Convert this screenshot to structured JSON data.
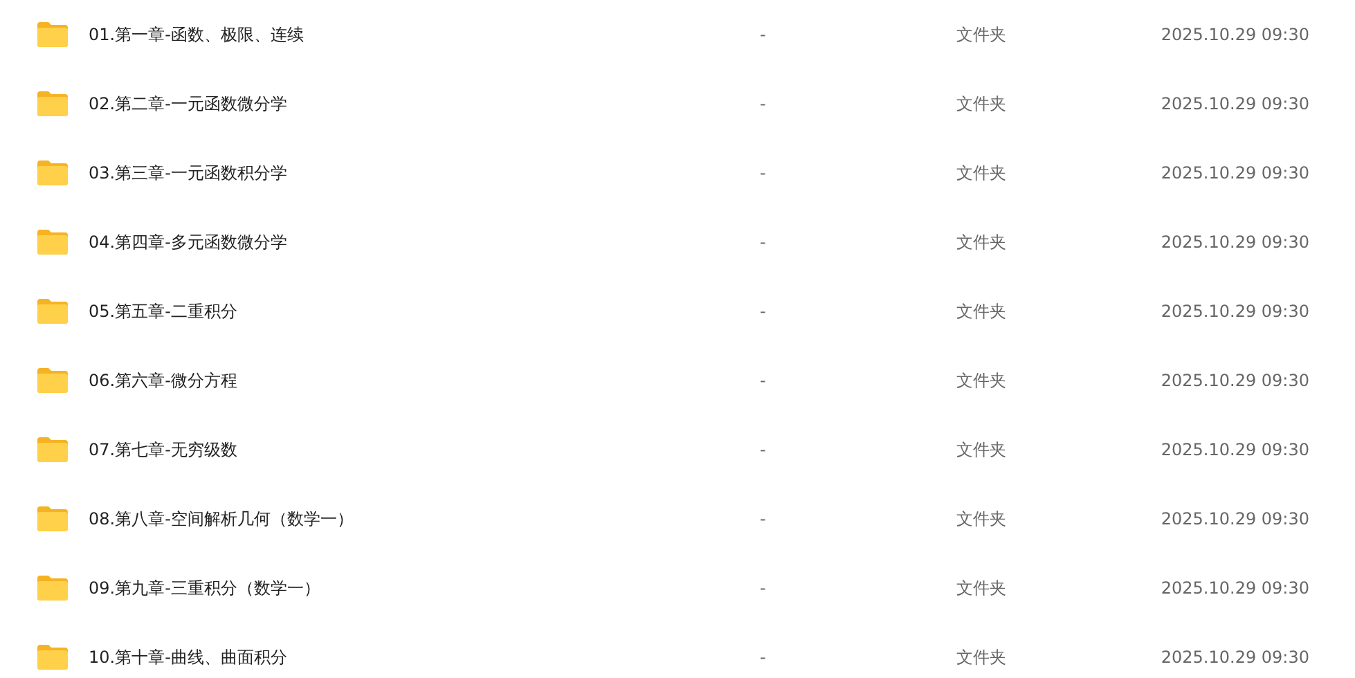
{
  "files": [
    {
      "name": "01.第一章-函数、极限、连续",
      "size": "-",
      "type": "文件夹",
      "modified": "2025.10.29 09:30"
    },
    {
      "name": "02.第二章-一元函数微分学",
      "size": "-",
      "type": "文件夹",
      "modified": "2025.10.29 09:30"
    },
    {
      "name": "03.第三章-一元函数积分学",
      "size": "-",
      "type": "文件夹",
      "modified": "2025.10.29 09:30"
    },
    {
      "name": "04.第四章-多元函数微分学",
      "size": "-",
      "type": "文件夹",
      "modified": "2025.10.29 09:30"
    },
    {
      "name": "05.第五章-二重积分",
      "size": "-",
      "type": "文件夹",
      "modified": "2025.10.29 09:30"
    },
    {
      "name": "06.第六章-微分方程",
      "size": "-",
      "type": "文件夹",
      "modified": "2025.10.29 09:30"
    },
    {
      "name": "07.第七章-无穷级数",
      "size": "-",
      "type": "文件夹",
      "modified": "2025.10.29 09:30"
    },
    {
      "name": "08.第八章-空间解析几何（数学一）",
      "size": "-",
      "type": "文件夹",
      "modified": "2025.10.29 09:30"
    },
    {
      "name": "09.第九章-三重积分（数学一）",
      "size": "-",
      "type": "文件夹",
      "modified": "2025.10.29 09:30"
    },
    {
      "name": "10.第十章-曲线、曲面积分",
      "size": "-",
      "type": "文件夹",
      "modified": "2025.10.29 09:30"
    }
  ]
}
